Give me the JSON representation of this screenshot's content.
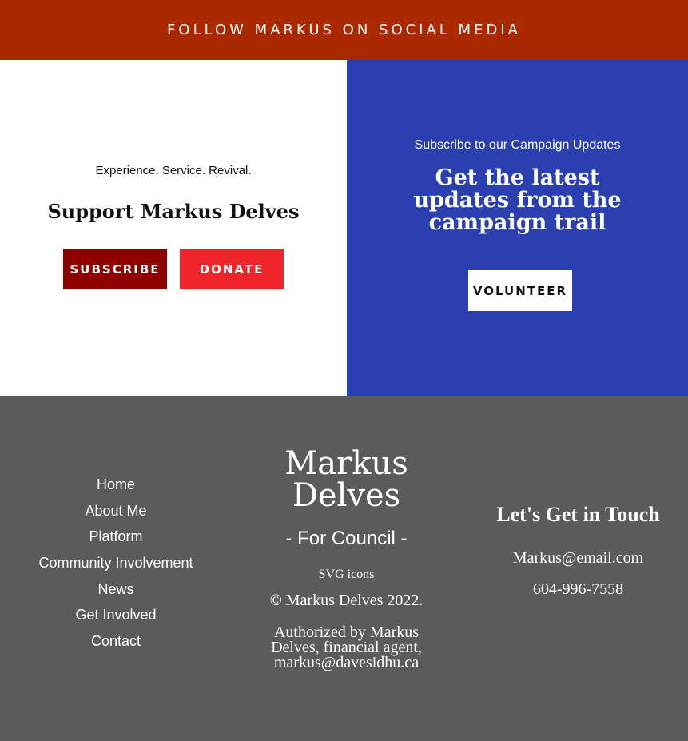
{
  "social_bar": {
    "label": "FOLLOW MARKUS ON SOCIAL MEDIA"
  },
  "support": {
    "tagline": "Experience. Service. Revival.",
    "heading": "Support Markus Delves",
    "subscribe_label": "SUBSCRIBE",
    "donate_label": "DONATE"
  },
  "updates": {
    "kicker": "Subscribe to our Campaign Updates",
    "heading": "Get the latest updates from the campaign trail",
    "volunteer_label": "VOLUNTEER"
  },
  "footer": {
    "nav": [
      "Home",
      "About Me",
      "Platform",
      "Community Involvement",
      "News",
      "Get Involved",
      "Contact"
    ],
    "brand_name": "Markus Delves",
    "brand_tagline": "- For Council -",
    "svg_credit": "SVG icons",
    "copyright": "© Markus Delves 2022.",
    "authorized": "Authorized by Markus Delves, financial agent, markus@davesidhu.ca",
    "contact_heading": "Let's Get in Touch",
    "email": "Markus@email.com",
    "phone": "604-996-7558"
  },
  "colors": {
    "social_bar": "#ab2900",
    "subscribe_button": "#8f0000",
    "donate_button": "#f0252a",
    "updates_panel": "#2a3fb0",
    "footer": "#5b5b5b"
  }
}
